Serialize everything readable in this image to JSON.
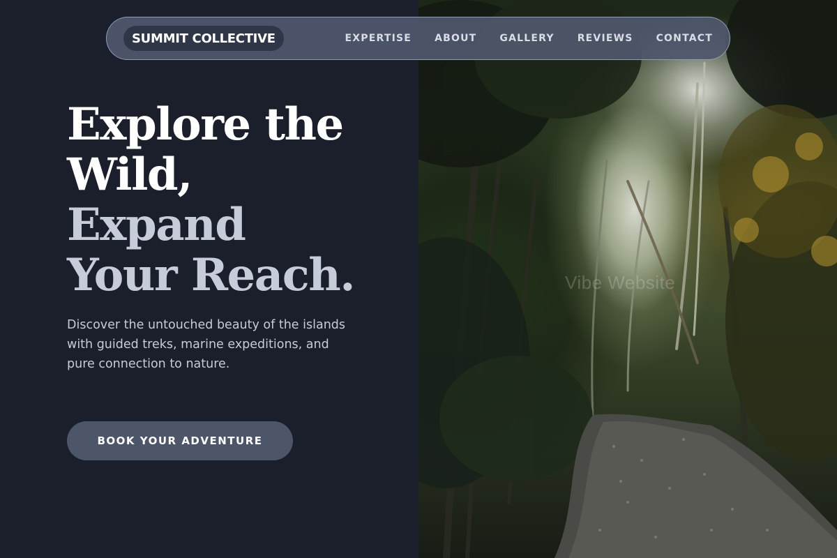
{
  "brand": {
    "name": "SUMMIT COLLECTIVE"
  },
  "nav": {
    "items": [
      "EXPERTISE",
      "ABOUT",
      "GALLERY",
      "REVIEWS",
      "CONTACT"
    ]
  },
  "hero": {
    "title_line1": "Explore the",
    "title_line2": "Wild,",
    "title_line3": "Expand",
    "title_line4": "Your Reach.",
    "description": "Discover the untouched beauty of the islands with guided treks, marine expeditions, and pure connection to nature.",
    "cta_label": "BOOK YOUR ADVENTURE"
  },
  "image": {
    "watermark": "Vibe Website"
  },
  "colors": {
    "page_background": "#1b1f2b",
    "nav_background": "#4e586c",
    "brand_pill": "#2f3648",
    "title_white": "#ffffff",
    "title_muted": "#c7ccda",
    "body_text": "#c6cbd6",
    "cta_background": "#4d5669"
  }
}
